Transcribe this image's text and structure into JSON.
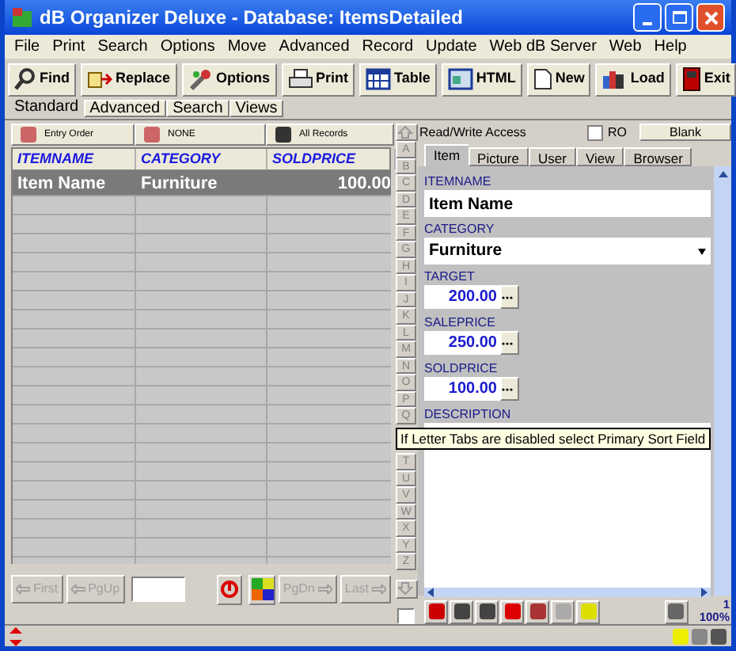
{
  "window": {
    "title": "dB Organizer Deluxe - Database: ItemsDetailed"
  },
  "menu": [
    "File",
    "Print",
    "Search",
    "Options",
    "Move",
    "Advanced",
    "Record",
    "Update",
    "Web dB Server",
    "Web",
    "Help"
  ],
  "toolbar": [
    "Find",
    "Replace",
    "Options",
    "Print",
    "Table",
    "HTML",
    "New",
    "Load",
    "Exit"
  ],
  "view_tabs": [
    {
      "label": "Standard",
      "selected": true
    },
    {
      "label": "Advanced",
      "selected": false
    },
    {
      "label": "Search",
      "selected": false
    },
    {
      "label": "Views",
      "selected": false
    }
  ],
  "sort_bar": [
    "Entry Order",
    "NONE",
    "All Records"
  ],
  "table": {
    "columns": [
      "ITEMNAME",
      "CATEGORY",
      "SOLDPRICE"
    ],
    "rows": [
      {
        "cells": [
          "Item Name",
          "Furniture",
          "100.00"
        ],
        "selected": true
      }
    ]
  },
  "nav": {
    "left": [
      {
        "label": "First",
        "disabled": true
      },
      {
        "label": "PgUp",
        "disabled": true
      }
    ],
    "right": [
      {
        "label": "PgDn",
        "disabled": true
      },
      {
        "label": "Last",
        "disabled": true
      }
    ]
  },
  "letters_top": [
    "A",
    "B",
    "C",
    "D",
    "E",
    "F",
    "G",
    "H",
    "I",
    "J",
    "K",
    "L",
    "M",
    "N",
    "O",
    "P",
    "Q"
  ],
  "letter_checkbox": {
    "checked": false
  },
  "tooltip": "If Letter Tabs are disabled select Primary Sort Field",
  "letters_bottom": [
    "T",
    "U",
    "V",
    "W",
    "X",
    "Y",
    "Z"
  ],
  "record": {
    "access": "Read/Write Access",
    "ro": {
      "label": "RO",
      "checked": false
    },
    "blank_button": "Blank",
    "tabs": [
      {
        "label": "Item",
        "selected": true
      },
      {
        "label": "Picture",
        "selected": false
      },
      {
        "label": "User",
        "selected": false
      },
      {
        "label": "View",
        "selected": false
      },
      {
        "label": "Browser",
        "selected": false
      }
    ],
    "fields": [
      {
        "label": "ITEMNAME",
        "value": "Item Name",
        "kind": "text"
      },
      {
        "label": "CATEGORY",
        "value": "Furniture",
        "kind": "dropdown"
      },
      {
        "label": "TARGET",
        "value": "200.00",
        "kind": "number"
      },
      {
        "label": "SALEPRICE",
        "value": "250.00",
        "kind": "number"
      },
      {
        "label": "SOLDPRICE",
        "value": "100.00",
        "kind": "number"
      },
      {
        "label": "DESCRIPTION",
        "kind": "memo"
      }
    ]
  },
  "status": {
    "record_number": "1",
    "zoom": "100%"
  }
}
